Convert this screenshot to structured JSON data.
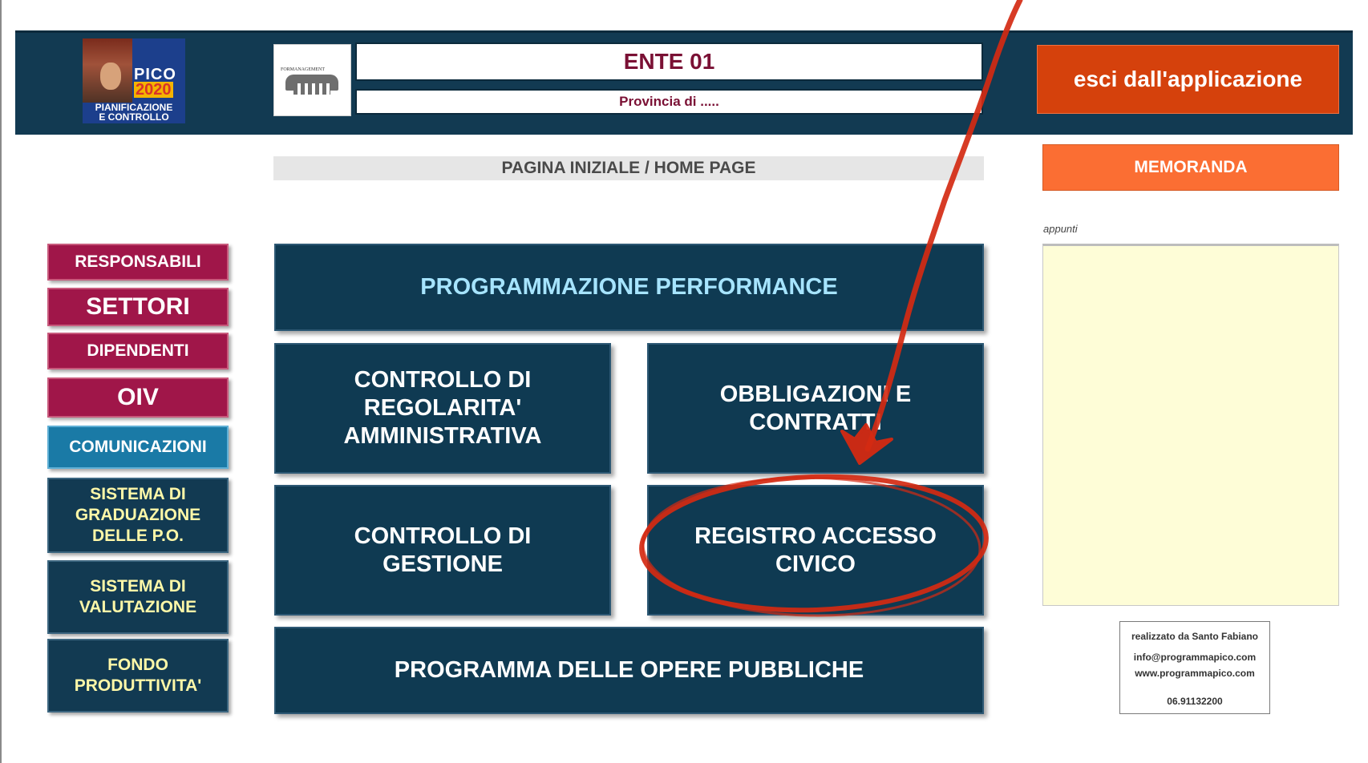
{
  "header": {
    "logo": {
      "brand": "PICO",
      "year": "2020",
      "subtitle_line1": "PIANIFICAZIONE",
      "subtitle_line2": "E CONTROLLO"
    },
    "partner_logo_text": "FORMANAGEMENT",
    "ente": "ENTE 01",
    "provincia": "Provincia di .....",
    "exit_label": "esci dall'applicazione"
  },
  "home_title": "PAGINA INIZIALE / HOME PAGE",
  "memoranda": {
    "button_label": "MEMORANDA",
    "notes_label": "appunti",
    "notes_value": ""
  },
  "sidebar": {
    "items": [
      {
        "label": "RESPONSABILI"
      },
      {
        "label": "SETTORI"
      },
      {
        "label": "DIPENDENTI"
      },
      {
        "label": "OIV"
      },
      {
        "label": "COMUNICAZIONI"
      },
      {
        "line1": "SISTEMA DI",
        "line2": "GRADUAZIONE",
        "line3": "DELLE P.O."
      },
      {
        "line1": "SISTEMA DI",
        "line2": "VALUTAZIONE"
      },
      {
        "line1": "FONDO",
        "line2": "PRODUTTIVITA'"
      }
    ]
  },
  "tiles": {
    "programmazione": "PROGRAMMAZIONE PERFORMANCE",
    "controllo_regolarita": {
      "line1": "CONTROLLO DI",
      "line2": "REGOLARITA'",
      "line3": "AMMINISTRATIVA"
    },
    "obbligazioni": {
      "line1": "OBBLIGAZIONI E",
      "line2": "CONTRATTI"
    },
    "controllo_gestione": {
      "line1": "CONTROLLO DI",
      "line2": "GESTIONE"
    },
    "registro_accesso": {
      "line1": "REGISTRO ACCESSO",
      "line2": "CIVICO"
    },
    "opere_pubbliche": "PROGRAMMA DELLE OPERE PUBBLICHE"
  },
  "credits": {
    "author": "realizzato da Santo Fabiano",
    "email": "info@programmapico.com",
    "website": "www.programmapico.com",
    "phone": "06.91132200"
  },
  "colors": {
    "header_bg": "#123a52",
    "tile_bg": "#0f3a52",
    "tile_highlight_text": "#a6e4ff",
    "sidebar_red": "#a01649",
    "sidebar_blue": "#1a7aa6",
    "sidebar_navy_text": "#fff8a8",
    "exit_button": "#d5410c",
    "memoranda_button": "#fb6e33",
    "annotation_red": "#d42a12"
  },
  "annotation": {
    "type": "hand-drawn arrow and ellipse highlighting REGISTRO ACCESSO CIVICO"
  }
}
